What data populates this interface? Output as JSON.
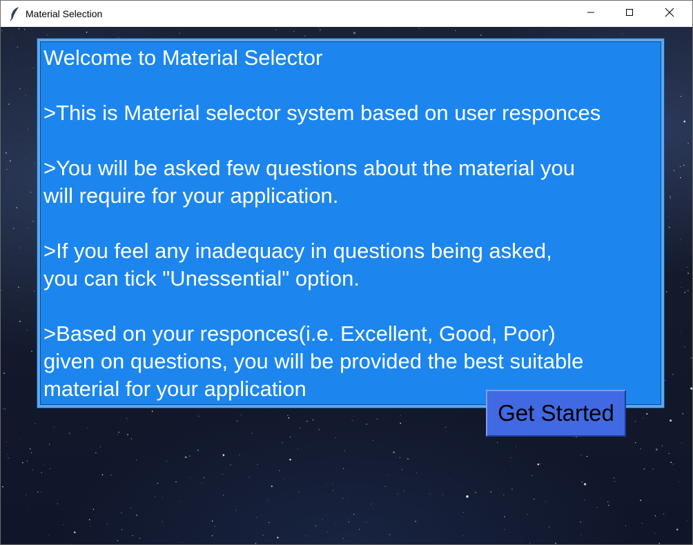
{
  "window": {
    "title": "Material Selection",
    "icon": "feather-icon",
    "controls": [
      "minimize-icon",
      "maximize-icon",
      "close-icon"
    ]
  },
  "panel": {
    "background_color": "#1c86ee",
    "text_color": "#ffffff",
    "message": "Welcome to Material Selector\n\n>This is Material selector system based on user responces\n\n>You will be asked few questions about the material you\nwill require for your application.\n\n>If you feel any inadequacy in questions being asked,\nyou can tick \"Unessential\" option.\n\n>Based on your responces(i.e. Excellent, Good, Poor)\ngiven on questions, you will be provided the best suitable\nmaterial for your application"
  },
  "actions": {
    "get_started_label": "Get Started",
    "button_color": "#4169e1"
  },
  "background": {
    "style": "starry night sky"
  }
}
